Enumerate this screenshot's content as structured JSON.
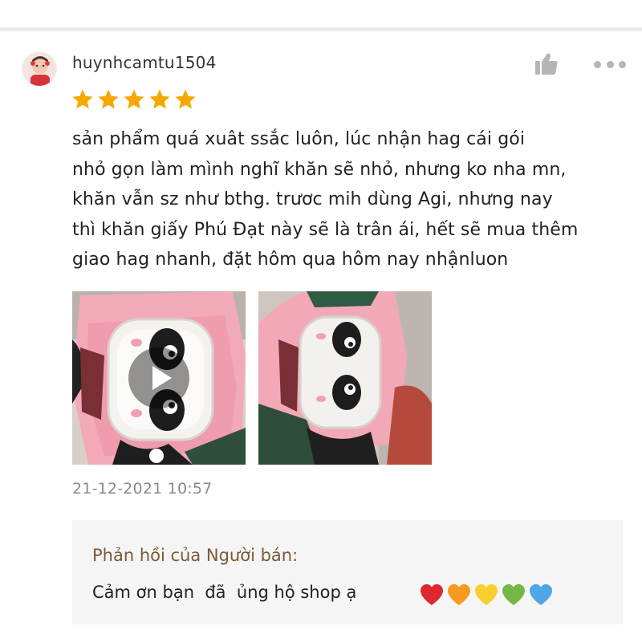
{
  "review": {
    "username": "huynhcamtu1504",
    "rating": 5,
    "rating_max": 5,
    "text_lines": [
      "sản phẩm quá xuât ssắc luôn, lúc nhận hag cái gói",
      "nhỏ gọn làm mình nghĩ khăn sẽ nhỏ, nhưng ko nha mn,",
      "khăn vẫn sz như bthg. trươc mih dùng Agi, nhưng nay",
      "thì khăn giấy Phú Đạt này sẽ là trân ái, hết sẽ mua thêm",
      "giao hag nhanh, đặt hôm qua hôm nay nhậnluon"
    ],
    "media": [
      {
        "kind": "video",
        "icon": "play-icon"
      },
      {
        "kind": "image"
      }
    ],
    "timestamp": "21-12-2021 10:57"
  },
  "icons": {
    "like": "thumbs-up-icon",
    "more": "more-options-icon",
    "star": "star-icon"
  },
  "seller_reply": {
    "title": "Phản hồi của Người bán:",
    "text": "Cảm ơn bạn  đã  ủng hộ shop ạ",
    "hearts": [
      {
        "name": "red-heart-icon",
        "color": "#e0262e"
      },
      {
        "name": "orange-heart-icon",
        "color": "#f79a1f"
      },
      {
        "name": "yellow-heart-icon",
        "color": "#f7cf2f"
      },
      {
        "name": "green-heart-icon",
        "color": "#73b844"
      },
      {
        "name": "blue-heart-icon",
        "color": "#4ea6e6"
      }
    ]
  },
  "colors": {
    "star": "#f6a700",
    "reply_title": "#7a5a37",
    "reply_background": "#f5f5f5",
    "timestamp": "#8a8a8a",
    "icon_grey": "#b5b5b5"
  }
}
